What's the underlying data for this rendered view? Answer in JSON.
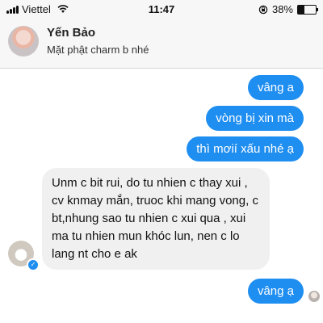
{
  "status_bar": {
    "carrier": "Viettel",
    "time": "11:47",
    "battery_percent": "38%",
    "battery_level": 0.38,
    "icons": [
      "signal-icon",
      "wifi-icon",
      "rotation-lock-icon",
      "battery-icon"
    ]
  },
  "header": {
    "name": "Yến Bảo",
    "status": "Mặt phật charm b nhé"
  },
  "messages": {
    "out": [
      "vâng a",
      "vòng bị xin mà",
      "thì mơií xấu nhé ạ",
      "vâng ạ"
    ],
    "in": "Unm c bit rui, do tu nhien c thay xui , cv knmay mắn, truoc khi mang vong, c bt,nhung sao tu nhien c xui qua , xui ma tu nhien mun khóc lun, nen c lo lang nt cho e ak"
  },
  "colors": {
    "outgoing_bubble": "#1f8ef1",
    "incoming_bubble": "#f1f0f0"
  }
}
